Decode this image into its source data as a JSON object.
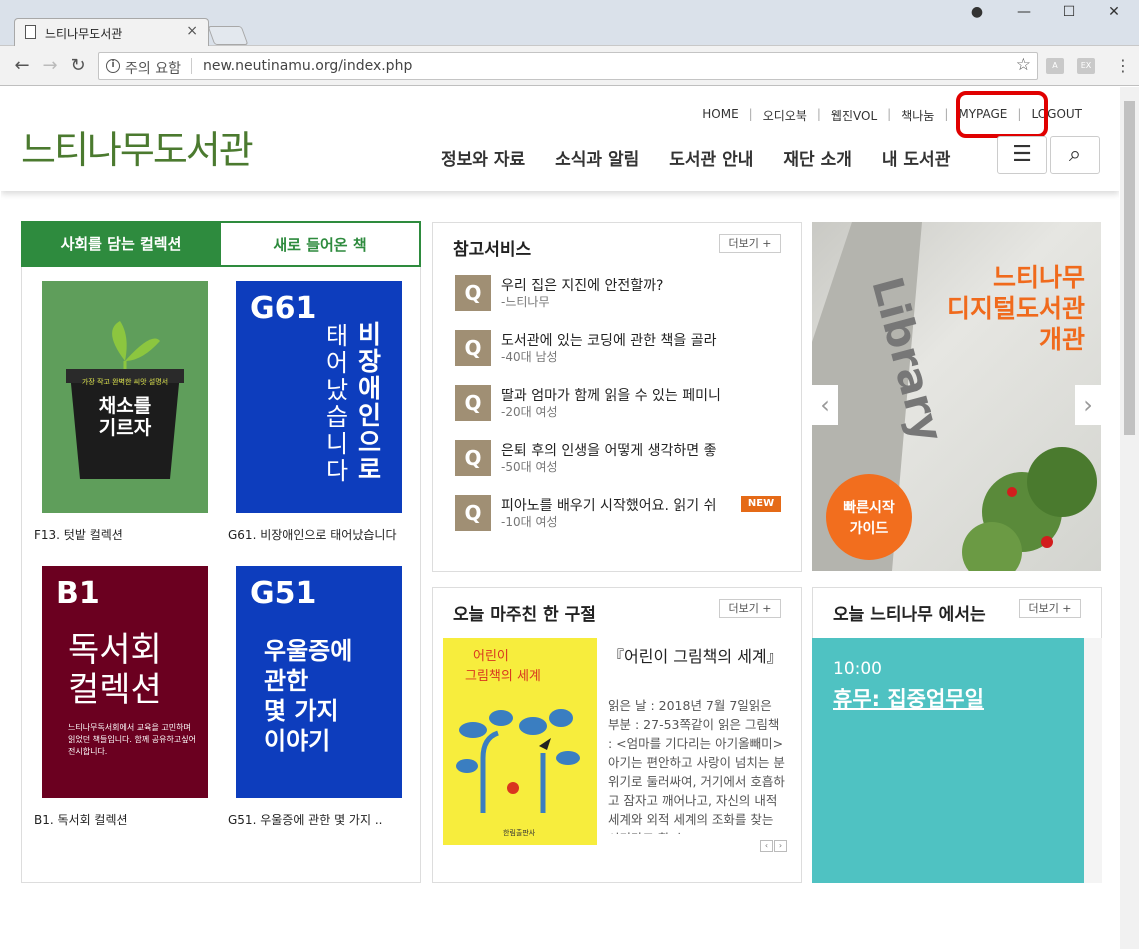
{
  "browser": {
    "tab_title": "느티나무도서관",
    "address_warning": "주의 요함",
    "url": "new.neutinamu.org/index.php"
  },
  "header": {
    "logo": "느티나무도서관",
    "util_links": [
      "HOME",
      "오디오북",
      "웹진VOL",
      "책나눔",
      "MYPAGE",
      "LOGOUT"
    ],
    "nav": [
      "정보와 자료",
      "소식과 알림",
      "도서관 안내",
      "재단 소개",
      "내 도서관"
    ]
  },
  "collection": {
    "tab_active": "사회를 담는 컬렉션",
    "tab_other": "새로 들어온 책",
    "books": [
      {
        "code": "",
        "cover_title": "채소를\n기르자",
        "cover_top": "가장 작고 완벽한 씨앗 설명서",
        "caption": "F13. 텃밭 컬렉션"
      },
      {
        "code": "G61",
        "cover_title": "비장애인으로 태어났습니다",
        "caption": "G61. 비장애인으로 태어났습니다"
      },
      {
        "code": "B1",
        "cover_title": "독서회\n컬렉션",
        "cover_sub": "느티나무독서회에서 교육을 고민하며 읽었던 책들입니다. 함께 공유하고싶어 전시합니다.",
        "caption": "B1. 독서회 컬렉션"
      },
      {
        "code": "G51",
        "cover_title": "우울증에\n관한\n몇 가지\n이야기",
        "caption": "G51. 우울증에 관한 몇 가지 .."
      }
    ]
  },
  "reference": {
    "title": "참고서비스",
    "more": "더보기 +",
    "items": [
      {
        "q": "Q",
        "title": "우리 집은 지진에 안전할까?",
        "sub": "-느티나무"
      },
      {
        "q": "Q",
        "title": "도서관에 있는 코딩에 관한 책을 골라",
        "sub": "-40대 남성"
      },
      {
        "q": "Q",
        "title": "딸과 엄마가 함께 읽을 수 있는 페미니",
        "sub": "-20대 여성"
      },
      {
        "q": "Q",
        "title": "은퇴 후의 인생을 어떻게 생각하면 좋",
        "sub": "-50대 여성"
      },
      {
        "q": "Q",
        "title": "피아노를 배우기 시작했어요. 읽기 쉬",
        "sub": "-10대 여성",
        "badge": "NEW"
      }
    ]
  },
  "banner": {
    "text_lines": [
      "느티나무",
      "디지털도서관",
      "개관"
    ],
    "circle_lines": [
      "빠른시작",
      "가이드"
    ]
  },
  "phrase": {
    "title": "오늘 마주친 한 구절",
    "more": "더보기 +",
    "book_title_lines": [
      "어린이",
      "그림책의 세계"
    ],
    "book_publisher": "한림출판사",
    "quote_title": "『어린이 그림책의 세계』",
    "quote_text": "읽은 날 : 2018년 7월 7일읽은 부분 : 27-53쪽같이 읽은 그림책 : <엄마를 기다리는 아기올빼미> 아기는 편안하고 사랑이 넘치는 분위기로 둘러싸여, 거기에서 호흡하고 잠자고 깨어나고, 자신의 내적 세계와 외적 세계의 조화를 찾는 시기라고 할 수"
  },
  "today": {
    "title": "오늘 느티나무 에서는",
    "more": "더보기 +",
    "time": "10:00",
    "event": "휴무: 집중업무일"
  },
  "colors": {
    "brand_green": "#2e8b3e",
    "logo_green": "#4b7a2f",
    "accent_orange": "#f06a1c",
    "q_brown": "#a08f74",
    "today_teal": "#4fc2c2",
    "highlight_red": "#e00000"
  }
}
